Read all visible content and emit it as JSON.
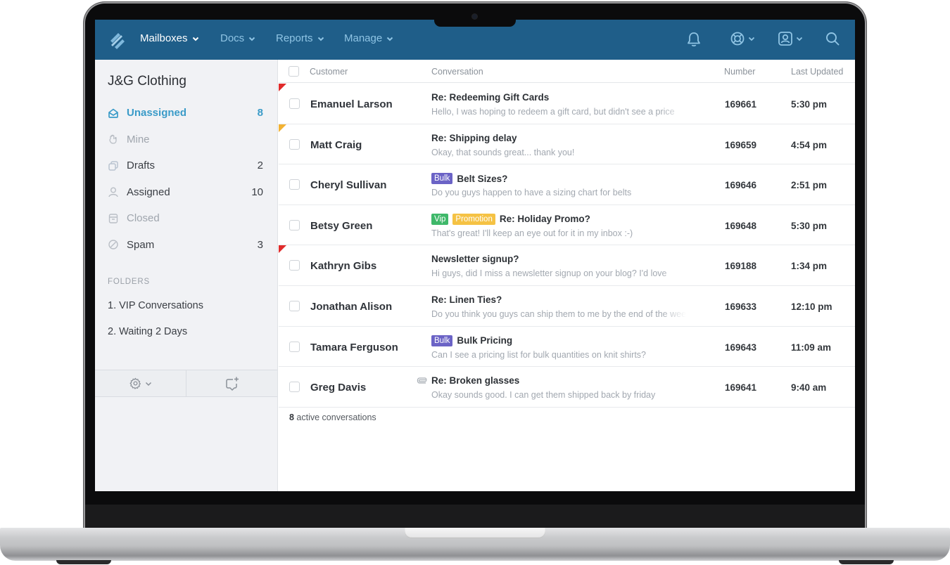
{
  "colors": {
    "nav_bg": "#1f5e89",
    "nav_link": "#8fc4e4",
    "nav_active": "#ffffff",
    "accent": "#3a9bc8",
    "flag_red": "#e02b2b",
    "flag_orange": "#f2b233",
    "tag_bulk": "#6b63c6",
    "tag_vip": "#3fb86a",
    "tag_promotion": "#f5c244"
  },
  "topnav": {
    "logo_icon": "helpscout-logo-icon",
    "items": [
      {
        "label": "Mailboxes",
        "active": true
      },
      {
        "label": "Docs",
        "active": false
      },
      {
        "label": "Reports",
        "active": false
      },
      {
        "label": "Manage",
        "active": false
      }
    ],
    "right_icons": [
      "bell-icon",
      "lifebuoy-icon",
      "user-account-icon",
      "search-icon"
    ]
  },
  "sidebar": {
    "mailbox_name": "J&G Clothing",
    "items": [
      {
        "label": "Unassigned",
        "count": "8",
        "icon": "inbox-open-icon",
        "state": "active"
      },
      {
        "label": "Mine",
        "count": "",
        "icon": "hand-icon",
        "state": "muted"
      },
      {
        "label": "Drafts",
        "count": "2",
        "icon": "drafts-icon",
        "state": "normal"
      },
      {
        "label": "Assigned",
        "count": "10",
        "icon": "person-icon",
        "state": "normal"
      },
      {
        "label": "Closed",
        "count": "",
        "icon": "archive-icon",
        "state": "muted"
      },
      {
        "label": "Spam",
        "count": "3",
        "icon": "spam-block-icon",
        "state": "normal"
      }
    ],
    "folders_header": "FOLDERS",
    "folders": [
      {
        "label": "1. VIP Conversations"
      },
      {
        "label": "2. Waiting 2 Days"
      }
    ],
    "footer": {
      "settings_icon": "gear-icon",
      "new_conversation_icon": "new-conversation-icon"
    }
  },
  "table": {
    "headers": {
      "customer": "Customer",
      "conversation": "Conversation",
      "number": "Number",
      "updated": "Last Updated"
    },
    "rows": [
      {
        "customer": "Emanuel Larson",
        "tags": [],
        "subject": "Re: Redeeming Gift Cards",
        "preview": "Hello, I was hoping to redeem a gift card, but didn't see a price",
        "number": "169661",
        "updated": "5:30 pm",
        "flag": "red",
        "attachment": false
      },
      {
        "customer": "Matt Craig",
        "tags": [],
        "subject": "Re: Shipping delay",
        "preview": "Okay, that sounds great... thank you!",
        "number": "169659",
        "updated": "4:54 pm",
        "flag": "orange",
        "attachment": false
      },
      {
        "customer": "Cheryl Sullivan",
        "tags": [
          {
            "label": "Bulk",
            "color": "#6b63c6"
          }
        ],
        "subject": "Belt Sizes?",
        "preview": "Do you guys happen to have a sizing chart for belts",
        "number": "169646",
        "updated": "2:51 pm",
        "flag": "",
        "attachment": false
      },
      {
        "customer": "Betsy Green",
        "tags": [
          {
            "label": "Vip",
            "color": "#3fb86a"
          },
          {
            "label": "Promotion",
            "color": "#f5c244"
          }
        ],
        "subject": "Re: Holiday Promo?",
        "preview": "That's great! I'll keep an eye out for it in my inbox :-)",
        "number": "169648",
        "updated": "5:30 pm",
        "flag": "",
        "attachment": false
      },
      {
        "customer": "Kathryn Gibs",
        "tags": [],
        "subject": "Newsletter signup?",
        "preview": "Hi guys, did I miss a newsletter signup on your blog? I'd love",
        "number": "169188",
        "updated": "1:34 pm",
        "flag": "red",
        "attachment": false
      },
      {
        "customer": "Jonathan Alison",
        "tags": [],
        "subject": "Re: Linen Ties?",
        "preview": "Do you think you guys can ship them to me by the end of the week",
        "number": "169633",
        "updated": "12:10 pm",
        "flag": "",
        "attachment": false
      },
      {
        "customer": "Tamara Ferguson",
        "tags": [
          {
            "label": "Bulk",
            "color": "#6b63c6"
          }
        ],
        "subject": "Bulk Pricing",
        "preview": "Can I see a pricing list for bulk quantities on knit shirts?",
        "number": "169643",
        "updated": "11:09 am",
        "flag": "",
        "attachment": false
      },
      {
        "customer": "Greg Davis",
        "tags": [],
        "subject": "Re: Broken glasses",
        "preview": "Okay sounds good. I can get them shipped back by friday",
        "number": "169641",
        "updated": "9:40 am",
        "flag": "",
        "attachment": true
      }
    ],
    "summary_count": "8",
    "summary_text": " active conversations"
  }
}
